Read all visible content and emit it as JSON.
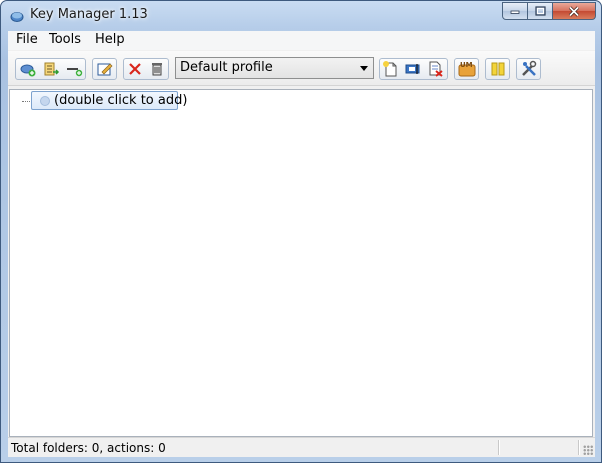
{
  "window": {
    "title": "Key Manager 1.13"
  },
  "menu": [
    {
      "label": "File"
    },
    {
      "label": "Tools"
    },
    {
      "label": "Help"
    }
  ],
  "toolbar": {
    "profile_value": "Default profile",
    "icons": [
      "add-folder-icon",
      "add-action-icon",
      "add-item-icon",
      "edit-icon",
      "delete-icon",
      "trash-icon",
      "new-profile-icon",
      "rename-profile-icon",
      "delete-profile-icon",
      "um-icon",
      "pause-icon",
      "settings-icon"
    ]
  },
  "tree": {
    "placeholder_node": "(double click to add)"
  },
  "status": {
    "summary": "Total folders: 0, actions: 0"
  },
  "colors": {
    "window_frame": "#3e5a7e",
    "close_button": "#c44a32",
    "tree_selection": "#dce9f9",
    "accent_orange": "#e8a23a"
  }
}
